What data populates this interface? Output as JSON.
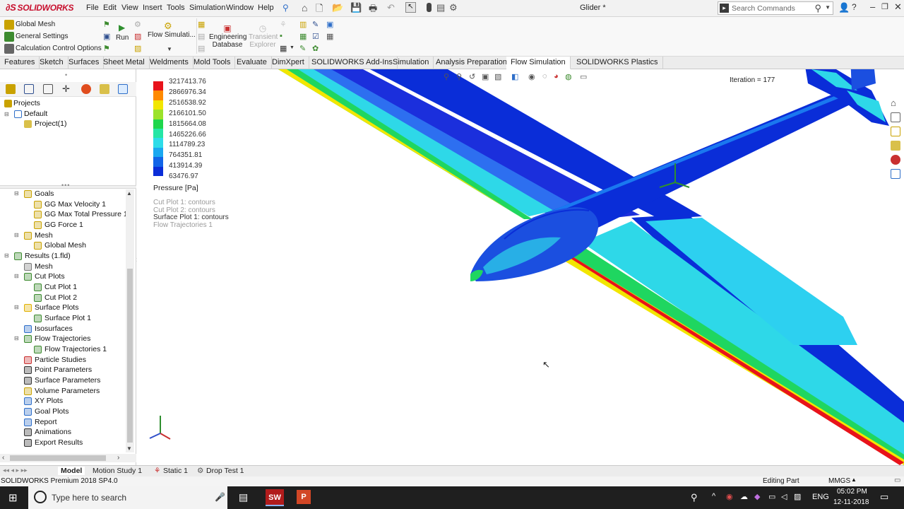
{
  "app": {
    "logo_text": "SOLIDWORKS",
    "menu": [
      "File",
      "Edit",
      "View",
      "Insert",
      "Tools",
      "Simulation",
      "Window",
      "Help"
    ],
    "document_title": "Glider *",
    "search_placeholder": "Search Commands"
  },
  "ribbon": {
    "left_items": [
      "Global Mesh",
      "General Settings",
      "Calculation Control Options"
    ],
    "run_label": "Run",
    "flow_sim_label": "Flow Simulati...",
    "eng_db_line1": "Engineering",
    "eng_db_line2": "Database",
    "transient_line1": "Transient",
    "transient_line2": "Explorer"
  },
  "command_tabs": [
    "Features",
    "Sketch",
    "Surfaces",
    "Sheet Metal",
    "Weldments",
    "Mold Tools",
    "Evaluate",
    "DimXpert",
    "SOLIDWORKS Add-Ins",
    "Simulation",
    "Analysis Preparation",
    "Flow Simulation",
    "SOLIDWORKS Plastics"
  ],
  "active_tab": "Flow Simulation",
  "project_tree": {
    "root": "Projects",
    "config": "Default",
    "project": "Project(1)"
  },
  "analysis_tree": [
    {
      "label": "Goals",
      "level": 1,
      "expander": "minus",
      "icon": "goals-icon",
      "color": "#c9a200"
    },
    {
      "label": "GG Max Velocity 1",
      "level": 2,
      "icon": "goal-icon",
      "color": "#c9a200"
    },
    {
      "label": "GG Max Total Pressure 1",
      "level": 2,
      "icon": "goal-icon",
      "color": "#c9a200"
    },
    {
      "label": "GG Force 1",
      "level": 2,
      "icon": "goal-icon",
      "color": "#c9a200"
    },
    {
      "label": "Mesh",
      "level": 1,
      "expander": "minus",
      "icon": "mesh-icon",
      "color": "#c9a200"
    },
    {
      "label": "Global Mesh",
      "level": 2,
      "icon": "mesh-icon",
      "color": "#c9a200"
    },
    {
      "label": "Results (1.fld)",
      "level": 0,
      "expander": "minus",
      "icon": "results-icon",
      "color": "#3d8b2f"
    },
    {
      "label": "Mesh",
      "level": 1,
      "icon": "mesh-icon",
      "color": "#7a7a7a"
    },
    {
      "label": "Cut Plots",
      "level": 1,
      "expander": "minus",
      "icon": "cut-plot-icon",
      "color": "#3d8b2f"
    },
    {
      "label": "Cut Plot 1",
      "level": 2,
      "icon": "cut-plot-icon",
      "color": "#3d8b2f"
    },
    {
      "label": "Cut Plot 2",
      "level": 2,
      "icon": "cut-plot-icon",
      "color": "#3d8b2f"
    },
    {
      "label": "Surface Plots",
      "level": 1,
      "expander": "minus",
      "icon": "surface-plot-icon",
      "color": "#e0b000"
    },
    {
      "label": "Surface Plot 1",
      "level": 2,
      "icon": "surface-plot-icon",
      "color": "#3d8b2f"
    },
    {
      "label": "Isosurfaces",
      "level": 1,
      "icon": "isosurface-icon",
      "color": "#2f6fc9"
    },
    {
      "label": "Flow Trajectories",
      "level": 1,
      "expander": "minus",
      "icon": "trajectory-icon",
      "color": "#3d8b2f"
    },
    {
      "label": "Flow Trajectories 1",
      "level": 2,
      "icon": "trajectory-icon",
      "color": "#3d8b2f"
    },
    {
      "label": "Particle Studies",
      "level": 1,
      "icon": "particle-icon",
      "color": "#c93030"
    },
    {
      "label": "Point Parameters",
      "level": 1,
      "icon": "point-param-icon",
      "color": "#333333"
    },
    {
      "label": "Surface Parameters",
      "level": 1,
      "icon": "surface-param-icon",
      "color": "#333333"
    },
    {
      "label": "Volume Parameters",
      "level": 1,
      "icon": "volume-param-icon",
      "color": "#c9a200"
    },
    {
      "label": "XY Plots",
      "level": 1,
      "icon": "xy-plot-icon",
      "color": "#2f6fc9"
    },
    {
      "label": "Goal Plots",
      "level": 1,
      "icon": "goal-plot-icon",
      "color": "#2f6fc9"
    },
    {
      "label": "Report",
      "level": 1,
      "icon": "report-icon",
      "color": "#2f6fc9"
    },
    {
      "label": "Animations",
      "level": 1,
      "icon": "animation-icon",
      "color": "#333333"
    },
    {
      "label": "Export Results",
      "level": 1,
      "icon": "export-icon",
      "color": "#333333"
    }
  ],
  "legend": {
    "values": [
      "3217413.76",
      "2866976.34",
      "2516538.92",
      "2166101.50",
      "1815664.08",
      "1465226.66",
      "1114789.23",
      "764351.81",
      "413914.39",
      "63476.97"
    ],
    "colors": [
      "#e8131b",
      "#ff8a00",
      "#f2e600",
      "#9be22a",
      "#1ed64c",
      "#25e6a5",
      "#2ddce8",
      "#1aa8f0",
      "#1265e8",
      "#0a2dd8"
    ],
    "title": "Pressure [Pa]"
  },
  "plot_list": [
    {
      "label": "Cut Plot 1: contours",
      "active": false
    },
    {
      "label": "Cut Plot 2: contours",
      "active": false
    },
    {
      "label": "Surface Plot 1: contours",
      "active": true
    },
    {
      "label": "Flow Trajectories 1",
      "active": false
    }
  ],
  "iteration_text": "Iteration = 177",
  "bottom_tabs": [
    "Model",
    "Motion Study 1",
    "Static 1",
    "Drop Test 1"
  ],
  "status": {
    "left": "SOLIDWORKS Premium 2018 SP4.0",
    "mode": "Editing Part",
    "units": "MMGS"
  },
  "taskbar": {
    "search_placeholder": "Type here to search",
    "lang": "ENG",
    "time": "05:02 PM",
    "date": "12-11-2018"
  }
}
